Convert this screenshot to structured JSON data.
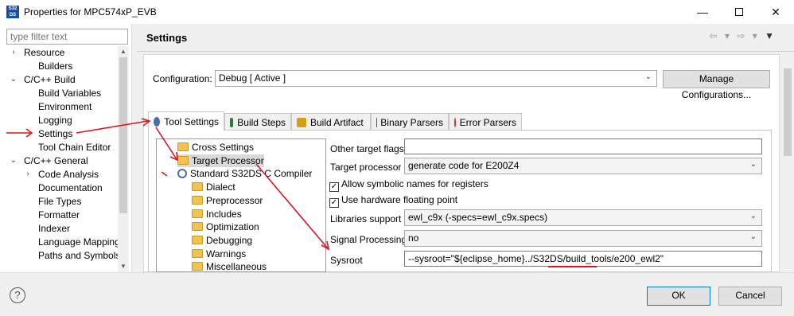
{
  "window": {
    "title": "Properties for MPC574xP_EVB",
    "app_icon_text": "S32DS",
    "minimize_icon": "minimize-icon",
    "maximize_icon": "maximize-icon",
    "close_icon": "close-icon"
  },
  "filter": {
    "placeholder": "type filter text"
  },
  "left_tree": [
    {
      "label": "Resource",
      "chevron": ">"
    },
    {
      "label": "Builders",
      "chevron": ""
    },
    {
      "label": "C/C++ Build",
      "chevron": "v"
    },
    {
      "label": "Build Variables",
      "chevron": ""
    },
    {
      "label": "Environment",
      "chevron": ""
    },
    {
      "label": "Logging",
      "chevron": ""
    },
    {
      "label": "Settings",
      "chevron": ""
    },
    {
      "label": "Tool Chain Editor",
      "chevron": ""
    },
    {
      "label": "C/C++ General",
      "chevron": "v"
    },
    {
      "label": "Code Analysis",
      "chevron": ">"
    },
    {
      "label": "Documentation",
      "chevron": ""
    },
    {
      "label": "File Types",
      "chevron": ""
    },
    {
      "label": "Formatter",
      "chevron": ""
    },
    {
      "label": "Indexer",
      "chevron": ""
    },
    {
      "label": "Language Mappings",
      "chevron": ""
    },
    {
      "label": "Paths and Symbols",
      "chevron": ""
    }
  ],
  "header": {
    "title": "Settings"
  },
  "configuration": {
    "label": "Configuration:",
    "value": "Debug  [ Active ]",
    "manage_button": "Manage Configurations..."
  },
  "tabs": [
    {
      "label": "Tool Settings",
      "icon": "gear-icon",
      "active": true
    },
    {
      "label": "Build Steps",
      "icon": "wrench-icon",
      "active": false
    },
    {
      "label": "Build Artifact",
      "icon": "trophy-icon",
      "active": false
    },
    {
      "label": "Binary Parsers",
      "icon": "binary-icon",
      "active": false
    },
    {
      "label": "Error Parsers",
      "icon": "error-icon",
      "active": false
    }
  ],
  "tool_tree": [
    {
      "label": "Cross Settings",
      "icon": "folder-icon"
    },
    {
      "label": "Target Processor",
      "icon": "folder-icon",
      "selected": true
    },
    {
      "label": "Standard S32DS C Compiler",
      "icon": "gear-icon"
    },
    {
      "label": "Dialect",
      "icon": "folder-icon"
    },
    {
      "label": "Preprocessor",
      "icon": "folder-icon"
    },
    {
      "label": "Includes",
      "icon": "folder-icon"
    },
    {
      "label": "Optimization",
      "icon": "folder-icon"
    },
    {
      "label": "Debugging",
      "icon": "folder-icon"
    },
    {
      "label": "Warnings",
      "icon": "folder-icon"
    },
    {
      "label": "Miscellaneous",
      "icon": "folder-icon"
    }
  ],
  "props": {
    "other_target_flags": {
      "label": "Other target flags",
      "value": ""
    },
    "target_processor": {
      "label": "Target processor",
      "value": "generate code for E200Z4"
    },
    "symbolic_names": {
      "label": "Allow symbolic names for registers",
      "checked": true
    },
    "hw_float": {
      "label": "Use hardware floating point",
      "checked": true
    },
    "libraries_support": {
      "label": "Libraries support",
      "value": "ewl_c9x (-specs=ewl_c9x.specs)"
    },
    "signal_processing": {
      "label": "Signal Processing",
      "value": "no"
    },
    "sysroot": {
      "label": "Sysroot",
      "value": "--sysroot=\"${eclipse_home}../S32DS/build_tools/e200_ewl2\""
    }
  },
  "footer": {
    "ok": "OK",
    "cancel": "Cancel",
    "help_icon": "help-icon"
  },
  "colors": {
    "annotation_red": "#e0141e",
    "selection": "#d9d9d9"
  }
}
